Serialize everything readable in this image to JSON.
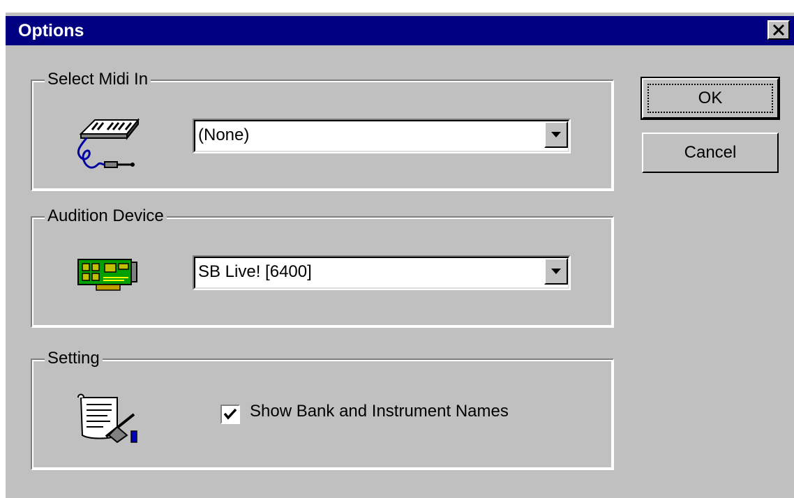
{
  "window": {
    "title": "Options",
    "close_icon": "close-icon"
  },
  "groups": {
    "midi_in": {
      "legend": "Select Midi In",
      "icon": "midi-keyboard-icon",
      "selected": "(None)"
    },
    "audition": {
      "legend": "Audition Device",
      "icon": "sound-card-icon",
      "selected": "SB Live! [6400]"
    },
    "setting": {
      "legend": "Setting",
      "icon": "document-pen-icon",
      "checkbox_label": "Show Bank and Instrument Names",
      "checked": true
    }
  },
  "buttons": {
    "ok": "OK",
    "cancel": "Cancel"
  },
  "colors": {
    "titlebar": "#000080",
    "face": "#c0c0c0"
  }
}
